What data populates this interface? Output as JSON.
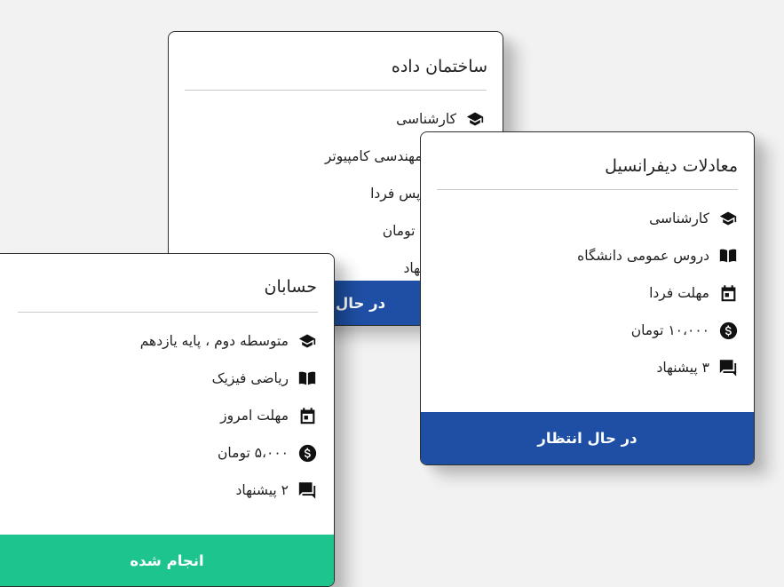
{
  "colors": {
    "background": "#f2f2f2",
    "pending_footer": "#1e4fa4",
    "done_footer": "#1ec48e",
    "icon": "#111111"
  },
  "cards": [
    {
      "title": "ساختمان داده",
      "rows": [
        {
          "icon": "graduation-cap-icon",
          "text": "کارشناسی"
        },
        {
          "icon": "book-icon",
          "text": "رشته مهندسی کامپیوتر"
        },
        {
          "icon": "calendar-icon",
          "text": "مهلت پس فردا"
        },
        {
          "icon": "dollar-icon",
          "text": "۱۵۰۰۰ تومان"
        },
        {
          "icon": "chat-icon",
          "text": "۱ پیشنهاد"
        }
      ],
      "status": "در حال انتظار"
    },
    {
      "title": "معادلات دیفرانسیل",
      "rows": [
        {
          "icon": "graduation-cap-icon",
          "text": "کارشناسی"
        },
        {
          "icon": "book-icon",
          "text": "دروس عمومی دانشگاه"
        },
        {
          "icon": "calendar-icon",
          "text": "مهلت فردا"
        },
        {
          "icon": "dollar-icon",
          "text": "۱۰،۰۰۰ تومان"
        },
        {
          "icon": "chat-icon",
          "text": "۳ پیشنهاد"
        }
      ],
      "status": "در حال انتظار"
    },
    {
      "title": "حسابان",
      "rows": [
        {
          "icon": "graduation-cap-icon",
          "text": "متوسطه دوم ، پایه یازدهم"
        },
        {
          "icon": "book-icon",
          "text": "ریاضی فیزیک"
        },
        {
          "icon": "calendar-icon",
          "text": "مهلت امروز"
        },
        {
          "icon": "dollar-icon",
          "text": "۵،۰۰۰ تومان"
        },
        {
          "icon": "chat-icon",
          "text": "۲ پیشنهاد"
        }
      ],
      "status": "انجام شده"
    }
  ]
}
